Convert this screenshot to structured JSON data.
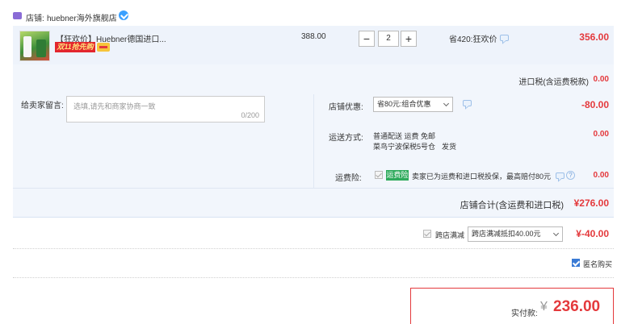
{
  "shop": {
    "label": "店铺:",
    "name": "huebner海外旗舰店"
  },
  "item": {
    "title": "【狂欢价】Huebner德国进口...",
    "promo_tag": "双11抢先购",
    "unit_price": "388.00",
    "quantity": "2",
    "decrease": "−",
    "increase": "+",
    "discount": "省420:狂欢价",
    "subtotal": "356.00"
  },
  "import_tax": {
    "label": "进口税(含运费税款)",
    "value": "0.00"
  },
  "message": {
    "label": "给卖家留言:",
    "placeholder": "选填,请先和商家协商一致",
    "counter": "0/200"
  },
  "shop_discount": {
    "label": "店铺优惠:",
    "selected": "省80元:组合优惠",
    "value": "-80.00"
  },
  "shipping": {
    "label": "运送方式:",
    "method": "普通配送 运费 免邮",
    "warehouse": "菜鸟宁波保税5号仓",
    "ship_text": "发货",
    "value": "0.00"
  },
  "shipping_insurance": {
    "label": "运费险:",
    "tag": "运费险",
    "desc": "卖家已为运费和进口税投保，最高赔付80元",
    "value": "0.00"
  },
  "shop_total": {
    "label": "店铺合计(含运费和进口税)",
    "value": "¥276.00"
  },
  "cross_store": {
    "label": "跨店满减",
    "selected": "跨店满减抵扣40.00元",
    "value": "¥-40.00"
  },
  "anonymous": {
    "label": "匿名购买"
  },
  "payment": {
    "label": "实付款:",
    "currency": "¥",
    "amount": "236.00"
  },
  "colors": {
    "accent_red": "#e4393c",
    "panel_blue": "#f2f6fc",
    "insurance_green": "#2eaa5c"
  },
  "icons": [
    "shop-icon",
    "verified-icon",
    "coupon-icon",
    "chat-bubble-icon",
    "help-icon",
    "chevron-down-icon",
    "checkbox-icon"
  ]
}
